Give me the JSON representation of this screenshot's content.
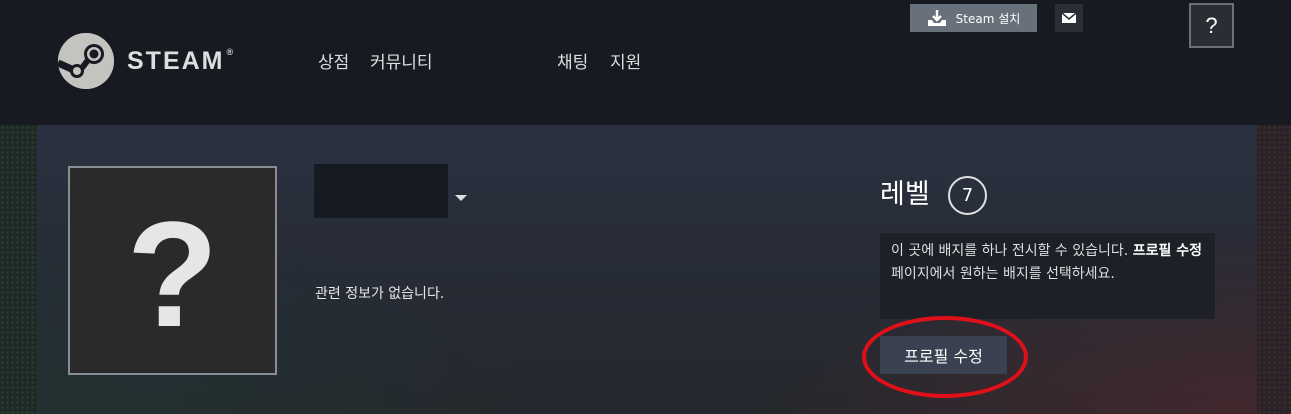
{
  "header": {
    "logo_text": "STEAM",
    "logo_reg": "®",
    "nav": [
      {
        "label": "상점"
      },
      {
        "label": "커뮤니티"
      },
      {
        "label": "채팅"
      },
      {
        "label": "지원"
      }
    ],
    "install_label": "Steam 설치",
    "help_label": "?"
  },
  "profile": {
    "avatar_placeholder": "?",
    "no_info_text": "관련 정보가 없습니다.",
    "level_label": "레벨",
    "level_value": "7",
    "badge_hint": {
      "part1": "이 곳에 배지를 하나 전시할 수 있습니다. ",
      "bold": "프로필 수정",
      "part2": " 페이지에서 원하는 배지를 선택하세요."
    },
    "edit_profile_label": "프로필 수정"
  },
  "colors": {
    "topbar_bg": "#171a21",
    "annotation_ring": "#e0101a",
    "edit_button_bg": "#3a4150"
  },
  "icons": [
    "steam-logo-icon",
    "download-icon",
    "envelope-icon",
    "caret-down-icon"
  ]
}
